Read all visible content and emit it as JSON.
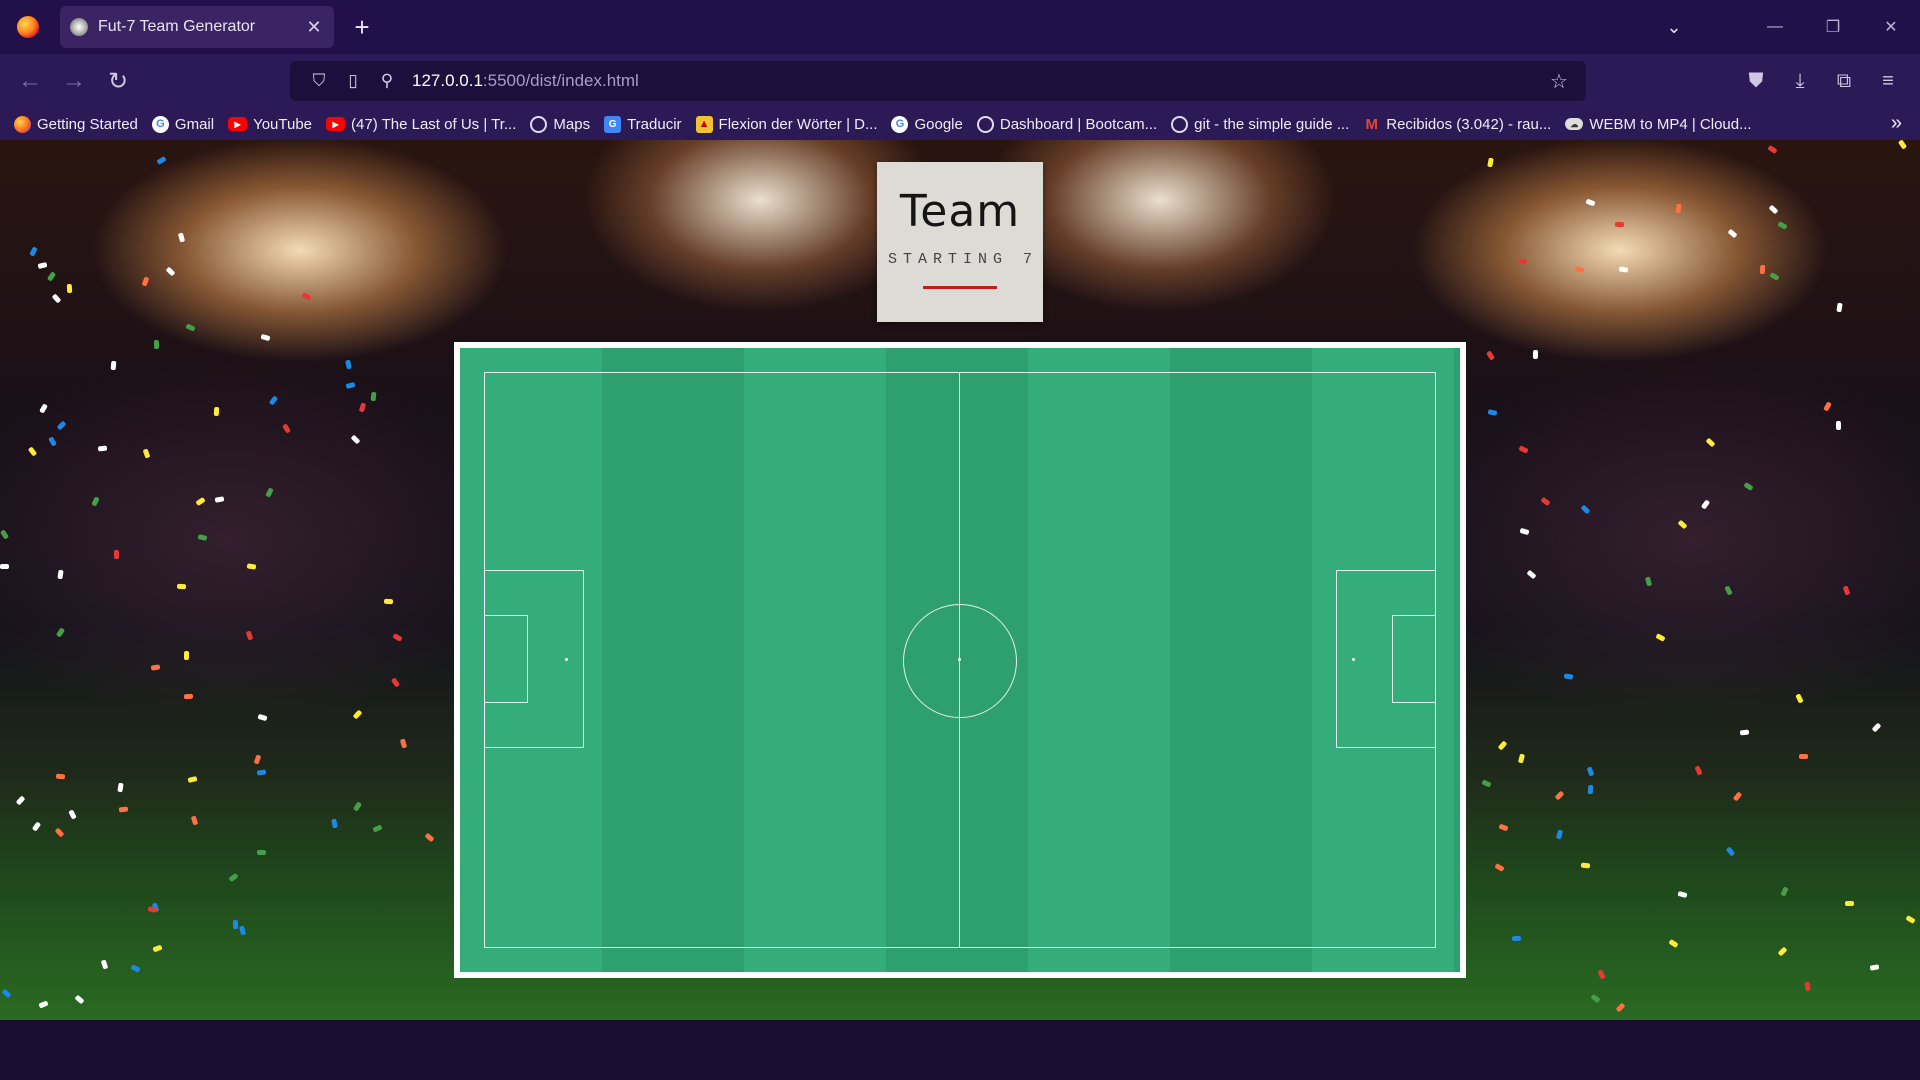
{
  "browser": {
    "tab_title": "Fut-7 Team Generator",
    "tab_close": "✕",
    "new_tab": "+",
    "url_host": "127.0.0.1",
    "url_rest": ":5500/dist/index.html",
    "bookmarks": [
      {
        "label": "Getting Started",
        "icon": "firefox-icon"
      },
      {
        "label": "Gmail",
        "icon": "google-icon"
      },
      {
        "label": "YouTube",
        "icon": "youtube-icon"
      },
      {
        "label": "(47) The Last of Us | Tr...",
        "icon": "youtube-icon"
      },
      {
        "label": "Maps",
        "icon": "globe-icon"
      },
      {
        "label": "Traducir",
        "icon": "translate-icon"
      },
      {
        "label": "Flexion der Wörter | D...",
        "icon": "flag-icon"
      },
      {
        "label": "Google",
        "icon": "google-icon"
      },
      {
        "label": "Dashboard | Bootcam...",
        "icon": "globe-icon"
      },
      {
        "label": "git - the simple guide ...",
        "icon": "globe-icon"
      },
      {
        "label": "Recibidos (3.042) - rau...",
        "icon": "gmail-icon"
      },
      {
        "label": "WEBM to MP4 | Cloud...",
        "icon": "cloud-icon"
      }
    ]
  },
  "page": {
    "title": "Team",
    "subtitle": "STARTING 7",
    "colors": {
      "pitch_light": "#34ad7a",
      "pitch_dark": "#2e9f6e",
      "accent": "#c41c1c"
    }
  }
}
